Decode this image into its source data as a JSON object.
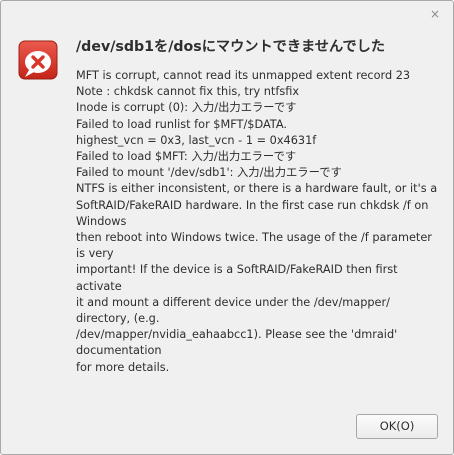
{
  "dialog": {
    "close_glyph": "×",
    "icon": "error-icon",
    "title": "/dev/sdb1を/dosにマウントできませんでした",
    "message_lines": [
      "MFT is corrupt, cannot read its unmapped extent record 23",
      "Note : chkdsk cannot fix this, try ntfsfix",
      "Inode is corrupt (0): 入力/出力エラーです",
      "Failed to load runlist for $MFT/$DATA.",
      "highest_vcn = 0x3, last_vcn - 1 = 0x4631f",
      "Failed to load $MFT: 入力/出力エラーです",
      "Failed to mount '/dev/sdb1': 入力/出力エラーです",
      "NTFS is either inconsistent, or there is a hardware fault, or it's a",
      "SoftRAID/FakeRAID hardware. In the first case run chkdsk /f on",
      "Windows",
      "then reboot into Windows twice. The usage of the /f parameter",
      "is very",
      "important! If the device is a SoftRAID/FakeRAID then first",
      "activate",
      "it and mount a different device under the /dev/mapper/",
      "directory, (e.g.",
      "/dev/mapper/nvidia_eahaabcc1). Please see the 'dmraid'",
      "documentation",
      "for more details."
    ],
    "ok_label": "OK(O)",
    "accent_color": "#d9362b"
  }
}
